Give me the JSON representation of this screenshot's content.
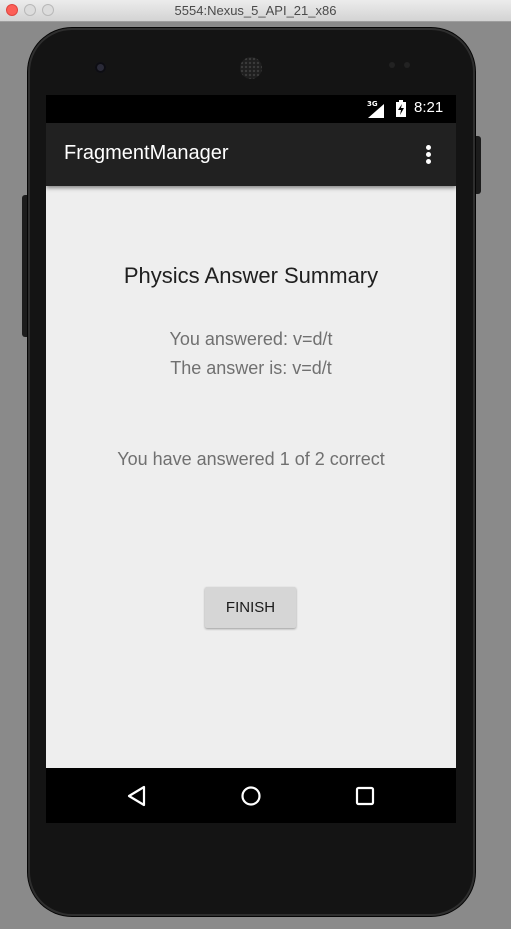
{
  "window": {
    "title": "5554:Nexus_5_API_21_x86"
  },
  "statusbar": {
    "network": "3G",
    "time": "8:21"
  },
  "appbar": {
    "title": "FragmentManager",
    "overflow_icon": "more-vert-icon"
  },
  "summary": {
    "title": "Physics Answer Summary",
    "you_answered": "You answered: v=d/t",
    "answer_is": "The answer is: v=d/t",
    "score": "You have answered 1 of 2 correct",
    "finish_label": "FINISH"
  },
  "navbar": {
    "icons": [
      "back-icon",
      "home-icon",
      "recents-icon"
    ]
  },
  "colors": {
    "appbar": "#212121",
    "screen_bg": "#eeeeee",
    "button_bg": "#d6d6d6"
  }
}
